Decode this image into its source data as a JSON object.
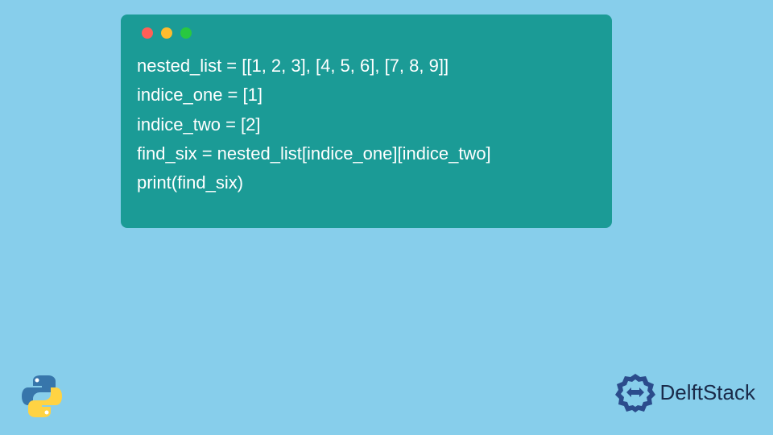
{
  "code": {
    "line1": "nested_list = [[1, 2, 3], [4, 5, 6], [7, 8, 9]]",
    "line2": "indice_one = [1]",
    "line3": "indice_two = [2]",
    "line4": "find_six = nested_list[indice_one][indice_two]",
    "line5": "print(find_six)"
  },
  "branding": {
    "delftstack_text": "DelftStack"
  },
  "colors": {
    "background": "#87CEEB",
    "code_window": "#1B9B96",
    "code_text": "#FFFFFF",
    "dot_red": "#FF5F57",
    "dot_yellow": "#FEBC2E",
    "dot_green": "#28C840",
    "brand_text": "#1A2B4A"
  }
}
